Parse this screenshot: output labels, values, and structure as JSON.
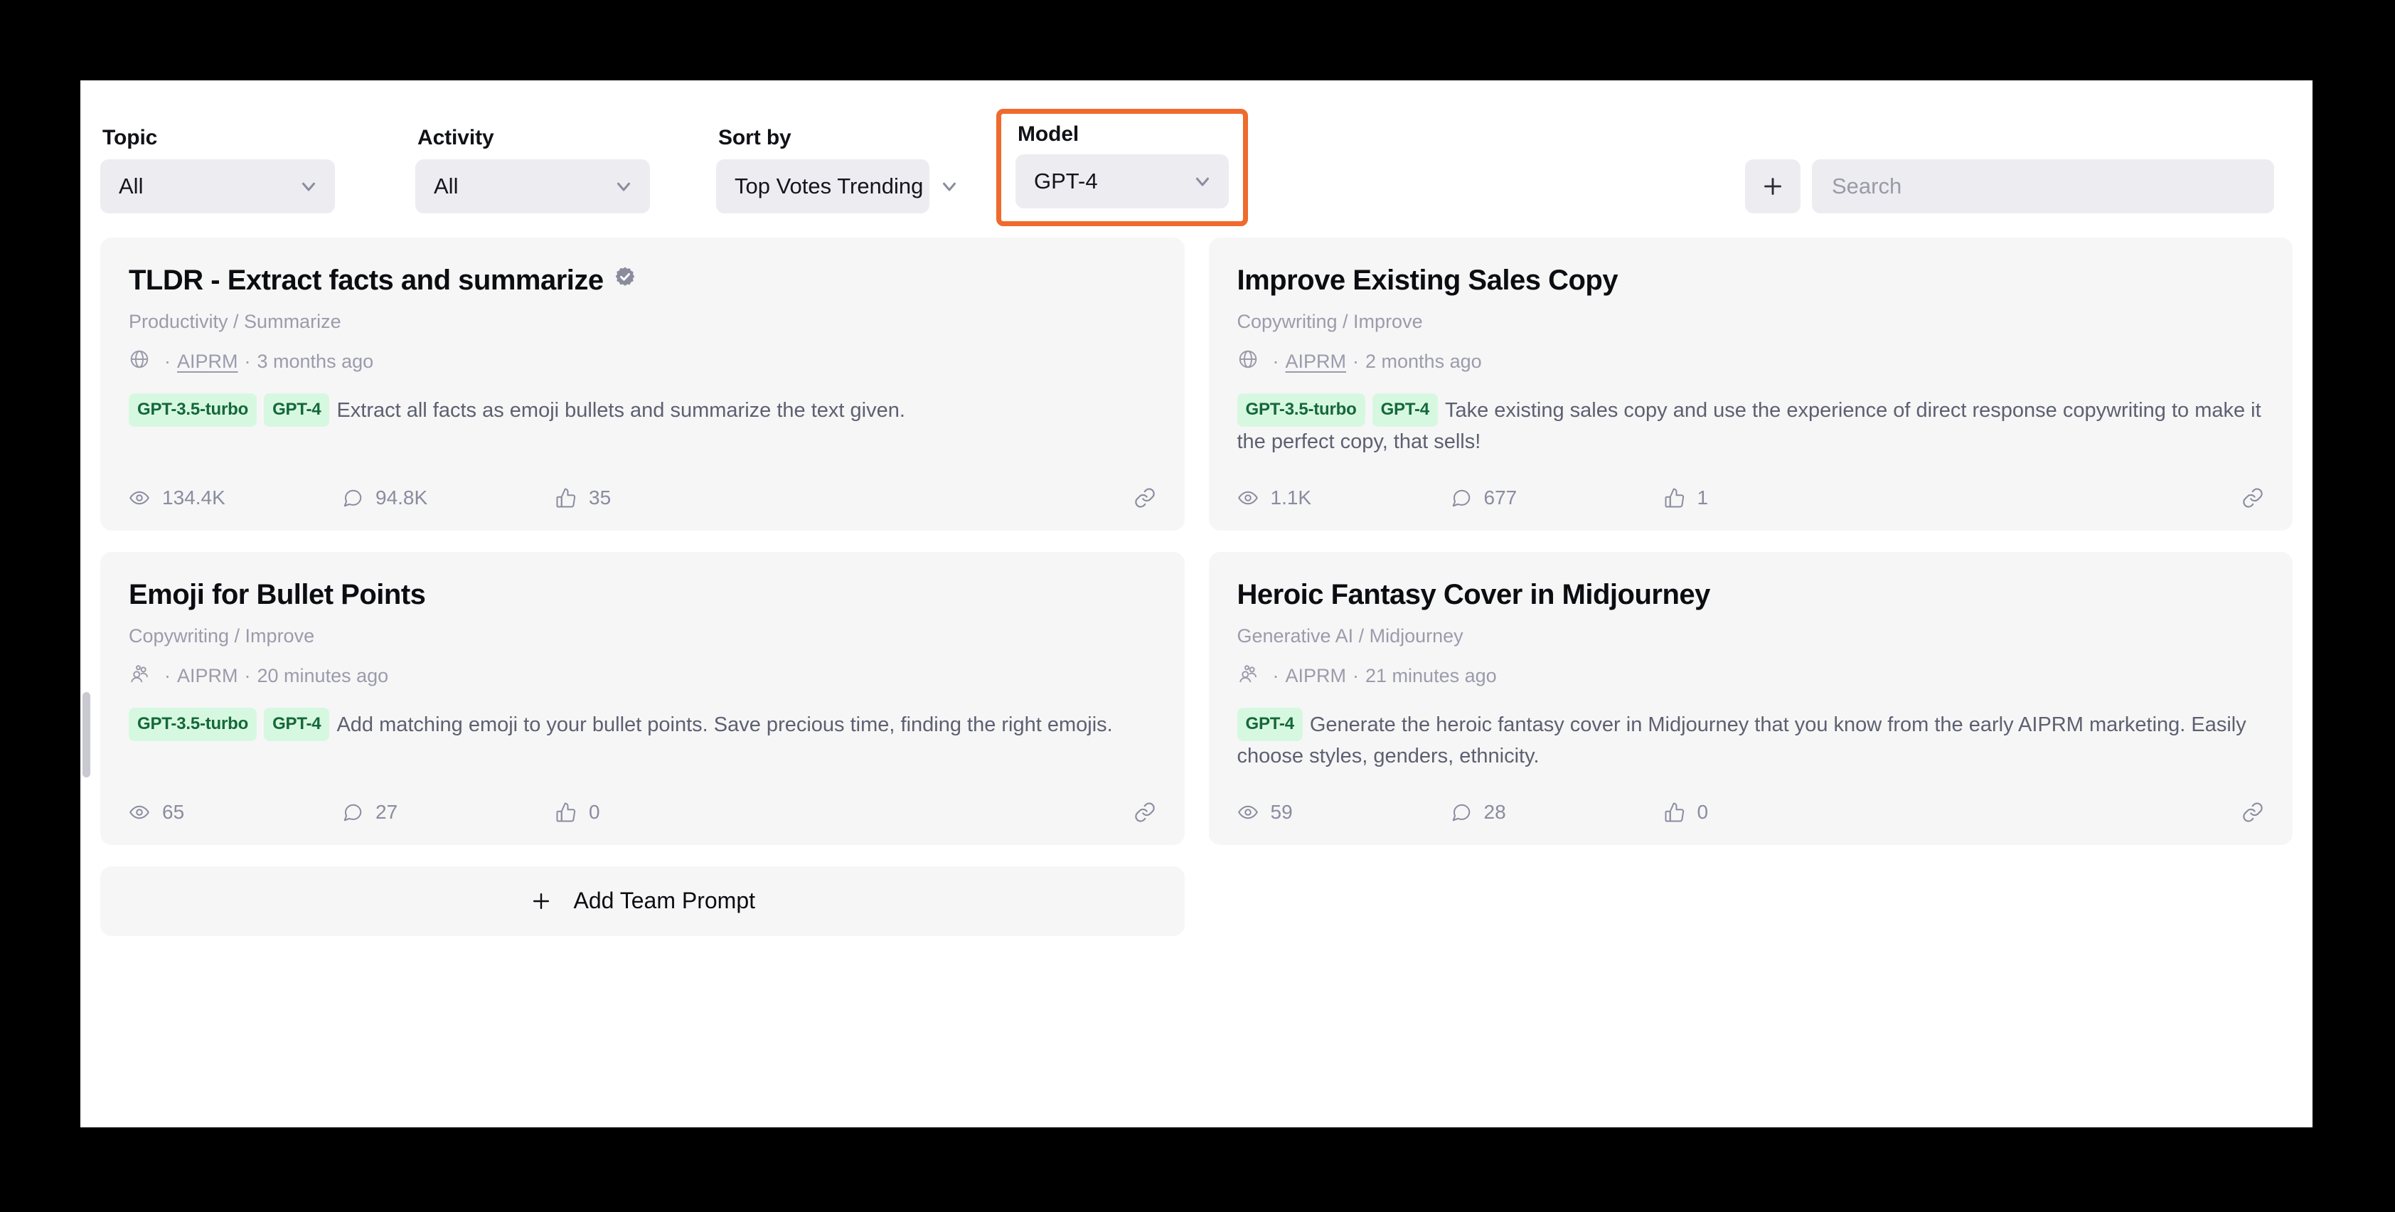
{
  "filters": [
    {
      "label": "Topic",
      "value": "All",
      "icon": "chevron-down-icon",
      "highlighted": false
    },
    {
      "label": "Activity",
      "value": "All",
      "icon": "chevron-down-icon",
      "highlighted": false
    },
    {
      "label": "Sort by",
      "value": "Top Votes Trending",
      "icon": "chevron-down-icon",
      "highlighted": false
    },
    {
      "label": "Model",
      "value": "GPT-4",
      "icon": "chevron-down-icon",
      "highlighted": true
    }
  ],
  "toolbar": {
    "add_icon": "plus-icon",
    "search_placeholder": "Search",
    "search_value": ""
  },
  "accent": {
    "highlight_border": "#ef6a2c",
    "tag_bg": "#d7f8e0",
    "tag_text": "#14683a",
    "card_bg": "#f6f6f7",
    "control_bg": "#ececf1"
  },
  "cards": [
    {
      "title": "TLDR - Extract facts and summarize",
      "verified": true,
      "verified_icon": "verified-badge-icon",
      "category": "Productivity / Summarize",
      "source_icon": "globe-icon",
      "author": "AIPRM",
      "author_linked": true,
      "time": "3 months ago",
      "tags": [
        "GPT-3.5-turbo",
        "GPT-4"
      ],
      "description": "Extract all facts as emoji bullets and summarize the text given.",
      "stats": {
        "views_icon": "eye-icon",
        "views": "134.4K",
        "comments_icon": "comment-icon",
        "comments": "94.8K",
        "votes_icon": "thumbs-up-icon",
        "votes": "35",
        "share_icon": "link-icon"
      }
    },
    {
      "title": "Improve Existing Sales Copy",
      "verified": false,
      "verified_icon": "",
      "category": "Copywriting / Improve",
      "source_icon": "globe-icon",
      "author": "AIPRM",
      "author_linked": true,
      "time": "2 months ago",
      "tags": [
        "GPT-3.5-turbo",
        "GPT-4"
      ],
      "description": "Take existing sales copy and use the experience of direct response copywriting to make it the perfect copy, that sells!",
      "stats": {
        "views_icon": "eye-icon",
        "views": "1.1K",
        "comments_icon": "comment-icon",
        "comments": "677",
        "votes_icon": "thumbs-up-icon",
        "votes": "1",
        "share_icon": "link-icon"
      }
    },
    {
      "title": "Emoji for Bullet Points",
      "verified": false,
      "verified_icon": "",
      "category": "Copywriting / Improve",
      "source_icon": "team-icon",
      "author": "AIPRM",
      "author_linked": false,
      "time": "20 minutes ago",
      "tags": [
        "GPT-3.5-turbo",
        "GPT-4"
      ],
      "description": "Add matching emoji to your bullet points. Save precious time, finding the right emojis.",
      "stats": {
        "views_icon": "eye-icon",
        "views": "65",
        "comments_icon": "comment-icon",
        "comments": "27",
        "votes_icon": "thumbs-up-icon",
        "votes": "0",
        "share_icon": "link-icon"
      }
    },
    {
      "title": "Heroic Fantasy Cover in Midjourney",
      "verified": false,
      "verified_icon": "",
      "category": "Generative AI / Midjourney",
      "source_icon": "team-icon",
      "author": "AIPRM",
      "author_linked": false,
      "time": "21 minutes ago",
      "tags": [
        "GPT-4"
      ],
      "description": "Generate the heroic fantasy cover in Midjourney that you know from the early AIPRM marketing. Easily choose styles, genders, ethnicity.",
      "stats": {
        "views_icon": "eye-icon",
        "views": "59",
        "comments_icon": "comment-icon",
        "comments": "28",
        "votes_icon": "thumbs-up-icon",
        "votes": "0",
        "share_icon": "link-icon"
      }
    }
  ],
  "add_team_prompt": {
    "icon": "plus-icon",
    "label": "Add Team Prompt"
  }
}
